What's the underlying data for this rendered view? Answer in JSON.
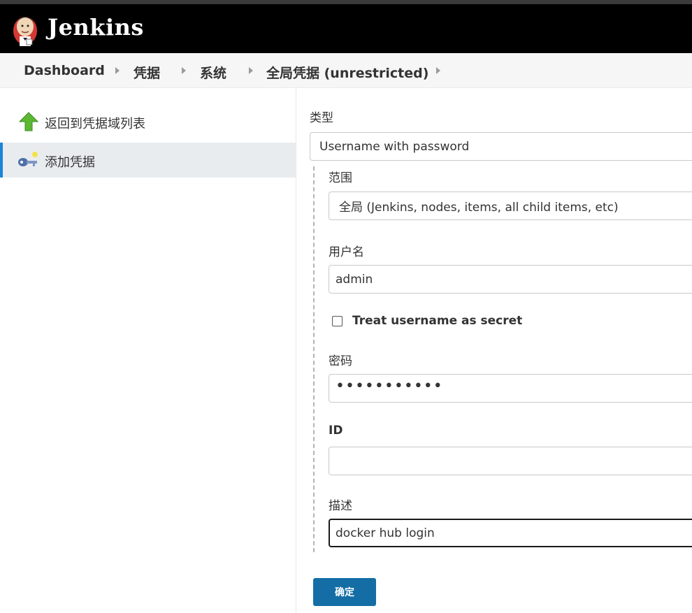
{
  "header": {
    "app_name": "Jenkins",
    "logo_icon": "jenkins-butler-icon"
  },
  "breadcrumbs": [
    "Dashboard",
    "凭据",
    "系统",
    "全局凭据 (unrestricted)"
  ],
  "sidebar": {
    "items": [
      {
        "label": "返回到凭据域列表",
        "icon": "up-arrow-icon",
        "active": false
      },
      {
        "label": "添加凭据",
        "icon": "key-icon",
        "active": true
      }
    ]
  },
  "form": {
    "kind_label": "类型",
    "kind_value": "Username with password",
    "scope_label": "范围",
    "scope_value": "全局 (Jenkins, nodes, items, all child items, etc)",
    "username_label": "用户名",
    "username_value": "admin",
    "treat_secret_label": "Treat username as secret",
    "treat_secret_checked": false,
    "password_label": "密码",
    "password_value": "•••••••••••",
    "id_label": "ID",
    "id_value": "",
    "description_label": "描述",
    "description_value": "docker hub login",
    "submit_label": "确定"
  },
  "colors": {
    "header_bg": "#000000",
    "active_accent": "#1b86d6",
    "submit_bg": "#146ea5"
  }
}
